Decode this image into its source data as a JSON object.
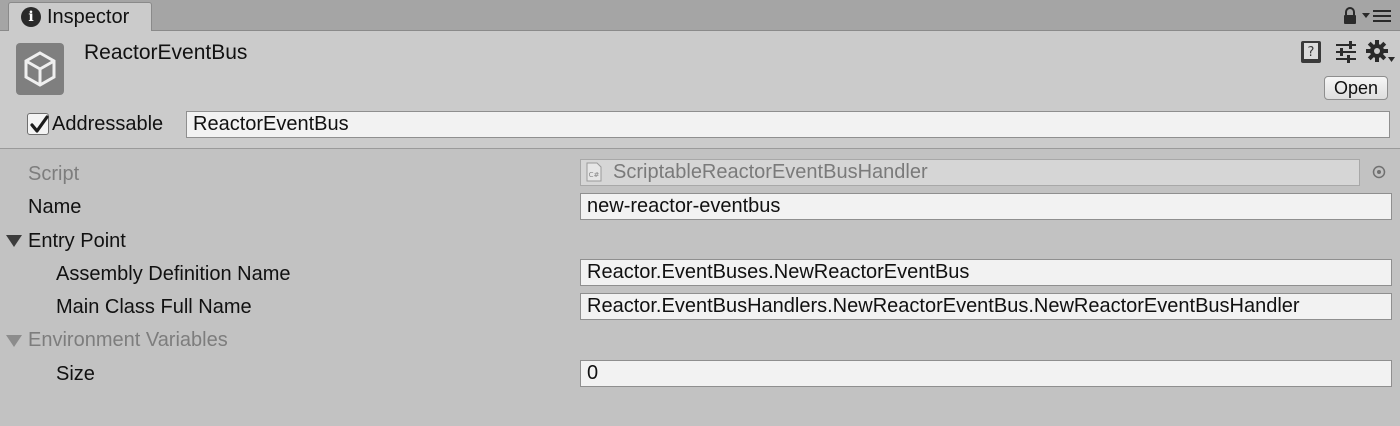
{
  "window": {
    "tab_label": "Inspector",
    "tab_icon": "info-icon"
  },
  "header": {
    "asset_name": "ReactorEventBus",
    "open_label": "Open",
    "addressable_label": "Addressable",
    "addressable_checked": true,
    "addressable_value": "ReactorEventBus"
  },
  "properties": {
    "script": {
      "label": "Script",
      "value": "ScriptableReactorEventBusHandler"
    },
    "name": {
      "label": "Name",
      "value": "new-reactor-eventbus"
    },
    "entry_point": {
      "label": "Entry Point",
      "assembly": {
        "label": "Assembly Definition Name",
        "value": "Reactor.EventBuses.NewReactorEventBus"
      },
      "main_class": {
        "label": "Main Class Full Name",
        "value": "Reactor.EventBusHandlers.NewReactorEventBus.NewReactorEventBusHandler"
      }
    },
    "env_vars": {
      "label": "Environment Variables",
      "size": {
        "label": "Size",
        "value": "0"
      }
    }
  },
  "colors": {
    "panel_bg": "#c2c2c2",
    "header_bg": "#cbcbcb",
    "tabbar_bg": "#a5a5a5",
    "field_bg": "#f2f2f2",
    "disabled_text": "#7d7d7d"
  }
}
